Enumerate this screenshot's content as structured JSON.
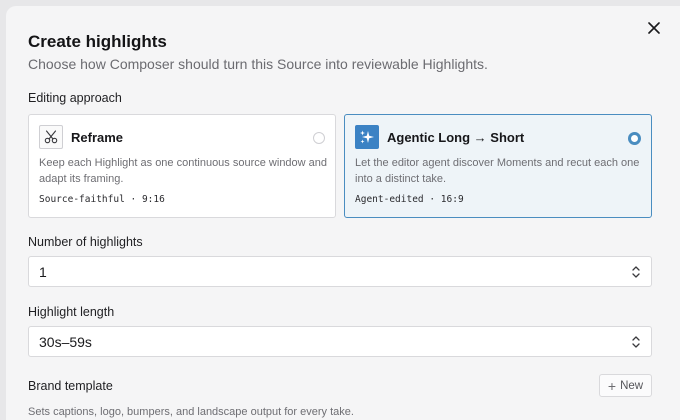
{
  "dialog": {
    "title": "Create highlights",
    "subtitle": "Choose how Composer should turn this Source into reviewable Highlights."
  },
  "editing_approach": {
    "label": "Editing approach",
    "options": [
      {
        "title": "Reframe",
        "description": "Keep each Highlight as one continuous source window and adapt its framing.",
        "meta": "Source-faithful · 9:16",
        "icon": "scissors-icon",
        "selected": false
      },
      {
        "title": "Agentic Long → Short",
        "description": "Let the editor agent discover Moments and recut each one into a distinct take.",
        "meta": "Agent-edited · 16:9",
        "icon": "sparkles-icon",
        "selected": true
      }
    ]
  },
  "number_of_highlights": {
    "label": "Number of highlights",
    "value": "1"
  },
  "highlight_length": {
    "label": "Highlight length",
    "value": "30s–59s"
  },
  "brand_template": {
    "label": "Brand template",
    "new_label": "New",
    "description": "Sets captions, logo, bumpers, and landscape output for every take."
  },
  "colors": {
    "accent": "#3b82c4",
    "selected_border": "#4a8dc0",
    "selected_bg": "#eef4f8"
  }
}
